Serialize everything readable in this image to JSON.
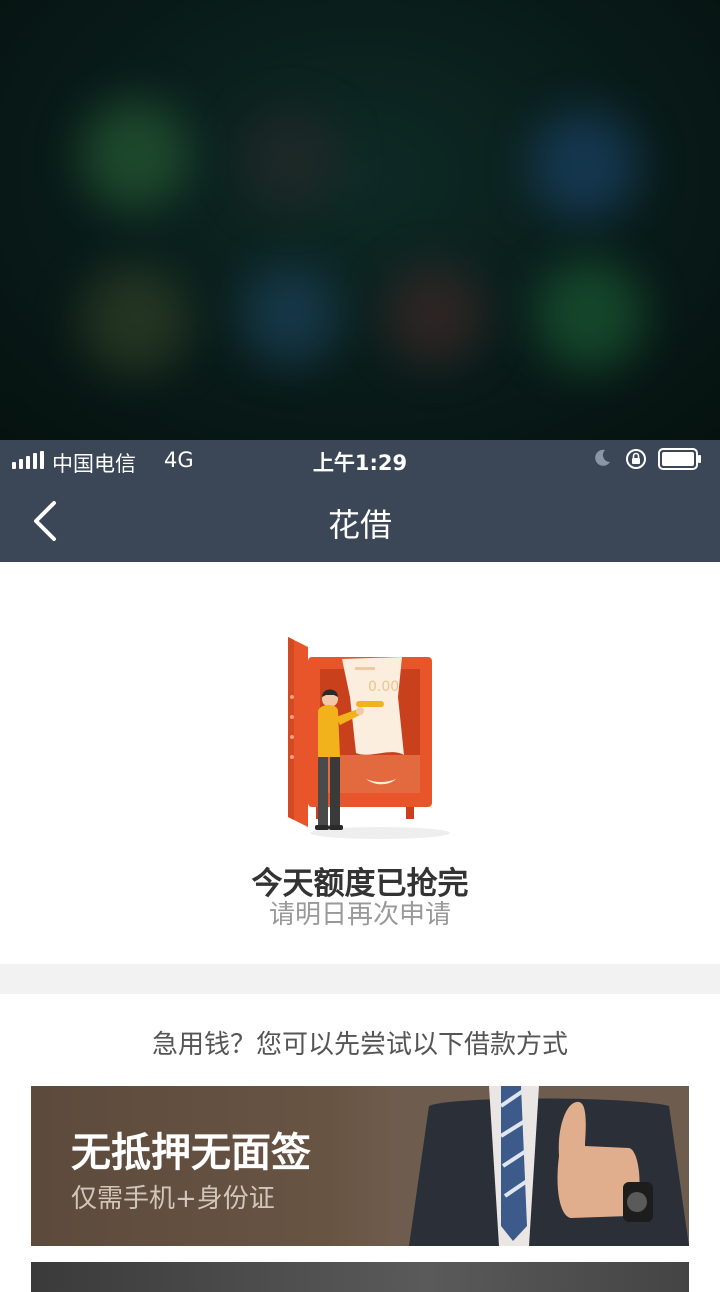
{
  "status_bar": {
    "carrier": "中国电信",
    "network": "4G",
    "time": "上午1:29"
  },
  "nav": {
    "title": "花借"
  },
  "empty_state": {
    "illustration_amount": "0.00",
    "title": "今天额度已抢完",
    "subtitle": "请明日再次申请"
  },
  "suggestion": {
    "hint": "急用钱？您可以先尝试以下借款方式"
  },
  "banners": [
    {
      "title": "无抵押无面签",
      "subtitle": "仅需手机+身份证"
    }
  ],
  "colors": {
    "nav_bg": "#3b4757",
    "safe_orange": "#e8552a",
    "figure_yellow": "#f2b21b"
  }
}
